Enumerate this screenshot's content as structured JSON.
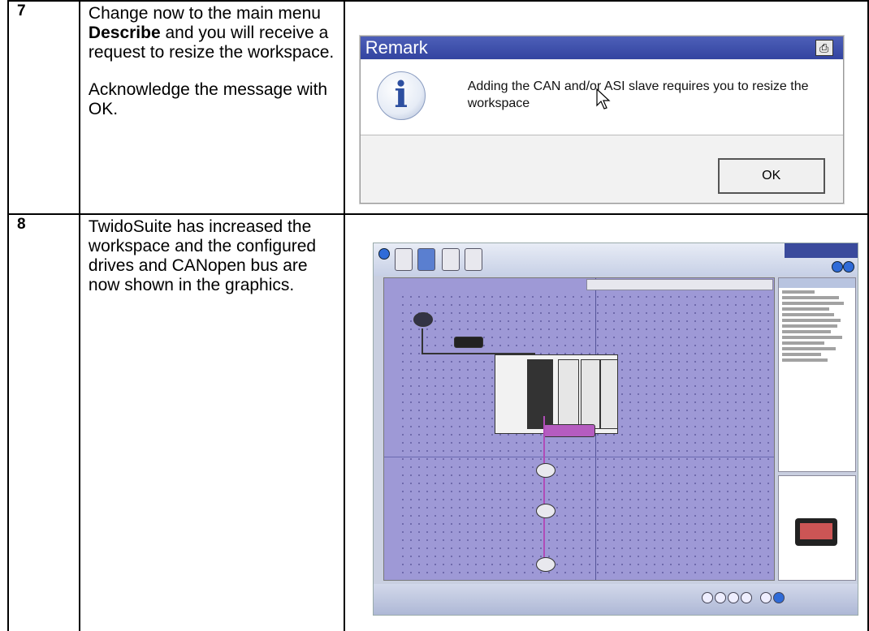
{
  "steps": [
    {
      "number": "7",
      "paragraphs": {
        "p1_before": "Change now to the main menu ",
        "p1_bold": "Describe",
        "p1_after": " and you will receive a request to resize the workspace.",
        "p2": "Acknowledge the message with OK."
      },
      "dialog": {
        "title": "Remark",
        "message": "Adding the CAN and/or ASI slave requires you to resize the workspace",
        "ok_label": "OK",
        "icons": [
          "info-icon",
          "print-icon",
          "mouse-cursor-icon"
        ]
      }
    },
    {
      "number": "8",
      "paragraphs": {
        "p1": "TwidoSuite has increased the workspace and the configured drives and CANopen bus are now shown in the graphics."
      }
    }
  ]
}
